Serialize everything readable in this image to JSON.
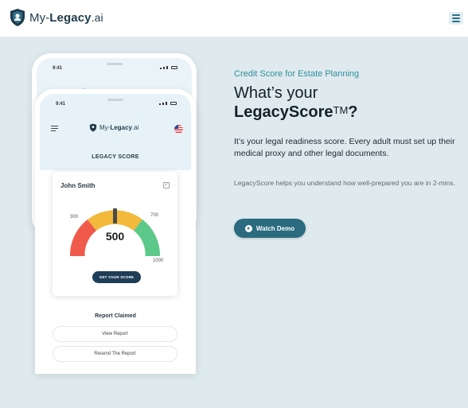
{
  "brand": {
    "name_prefix": "My-",
    "name_bold": "Legacy",
    "name_suffix": ".ai",
    "primary_color": "#2a6b7f",
    "background_color": "#dfeaee"
  },
  "header": {
    "menu_icon": "hamburger-icon"
  },
  "hero": {
    "eyebrow": "Credit Score for Estate Planning",
    "headline_line1": "What’s your",
    "headline_line2": "LegacyScore",
    "headline_tm": "TM",
    "headline_q": "?",
    "description_main": "It’s your legal readiness score. Every adult must set up their medical proxy and other legal documents.",
    "description_sub": "LegacyScore helps you understand how well-prepared you are in 2-mins.",
    "cta_label": "Watch Demo"
  },
  "phone": {
    "time": "9:41",
    "app_logo_prefix": "My-",
    "app_logo_bold": "Legacy",
    "app_logo_suffix": ".ai",
    "section_title": "LEGACY SCORE",
    "card": {
      "name": "John Smith",
      "score": "500",
      "tick_low": "300",
      "tick_high": "700",
      "tick_max": "1000",
      "button_label": "GET YOUR SCORE"
    },
    "claimed_title": "Report Claimed",
    "view_report_label": "View Report",
    "resend_report_label": "Resend The Report",
    "gauge_colors": [
      "#f05a4a",
      "#f2b93b",
      "#5cc98a"
    ]
  }
}
